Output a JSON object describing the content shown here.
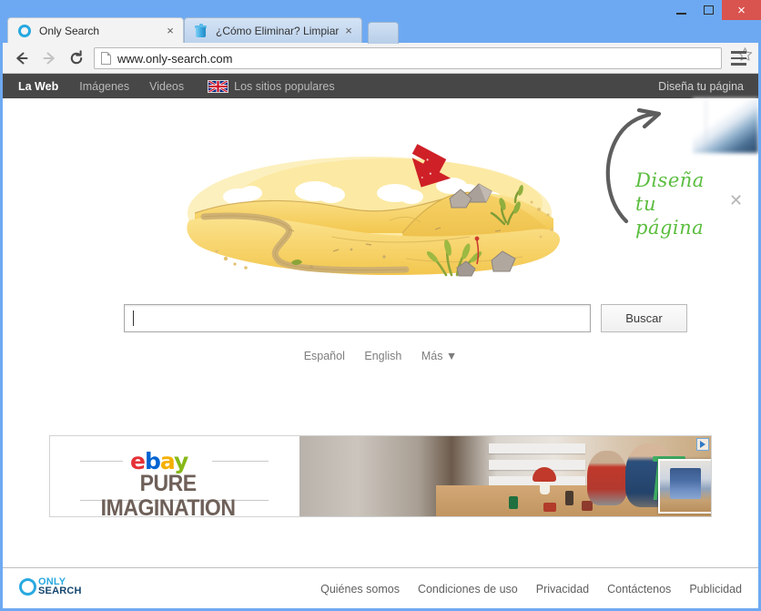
{
  "window": {
    "minimize_label": "–",
    "maximize_label": "□",
    "close_label": "×"
  },
  "tabs": [
    {
      "title": "Only Search",
      "favicon": "only-search-ring-icon",
      "close_label": "×",
      "active": true
    },
    {
      "title": "¿Cómo Eliminar? Limpiar :",
      "favicon": "trash-can-icon",
      "close_label": "×",
      "active": false
    }
  ],
  "toolbar": {
    "back_icon": "back-arrow-icon",
    "forward_icon": "forward-arrow-icon",
    "reload_icon": "reload-icon",
    "page_icon": "page-document-icon",
    "url": "www.only-search.com",
    "star_icon": "bookmark-star-icon",
    "menu_icon": "hamburger-menu-icon"
  },
  "sitenav": {
    "items": [
      {
        "label": "La Web",
        "active": true
      },
      {
        "label": "Imágenes",
        "active": false
      },
      {
        "label": "Videos",
        "active": false
      },
      {
        "label": "Los sitios populares",
        "active": false,
        "flag": "uk-flag-icon"
      }
    ],
    "right_link": "Diseña tu página"
  },
  "promo": {
    "line1": "Diseña",
    "line2": "tu",
    "line3": "página",
    "close_label": "✕",
    "arrow_icon": "curved-arrow-up-right-icon",
    "text_color": "#5bbd3f"
  },
  "hero": {
    "alt": "sand-dune-desert-illustration",
    "arrow_color": "#cf2027",
    "sand_color": "#f5c85a",
    "sand_light": "#fbe08a"
  },
  "search": {
    "value": "",
    "placeholder": "",
    "button_label": "Buscar"
  },
  "languages": [
    {
      "label": "Español"
    },
    {
      "label": "English"
    },
    {
      "label": "Más ▼"
    }
  ],
  "ad": {
    "brand_letters": [
      {
        "char": "e",
        "color": "#e53238"
      },
      {
        "char": "b",
        "color": "#0064d2"
      },
      {
        "char": "a",
        "color": "#f5af02"
      },
      {
        "char": "y",
        "color": "#86b817"
      }
    ],
    "tagline": "PURE IMAGINATION",
    "adchoices_icon": "adchoices-icon",
    "image_alt": "children-playing-with-toys-on-floor"
  },
  "footer": {
    "logo_only": "ONLY",
    "logo_search": "SEARCH",
    "links": [
      "Quiénes somos",
      "Condiciones de uso",
      "Privacidad",
      "Contáctenos",
      "Publicidad"
    ]
  }
}
